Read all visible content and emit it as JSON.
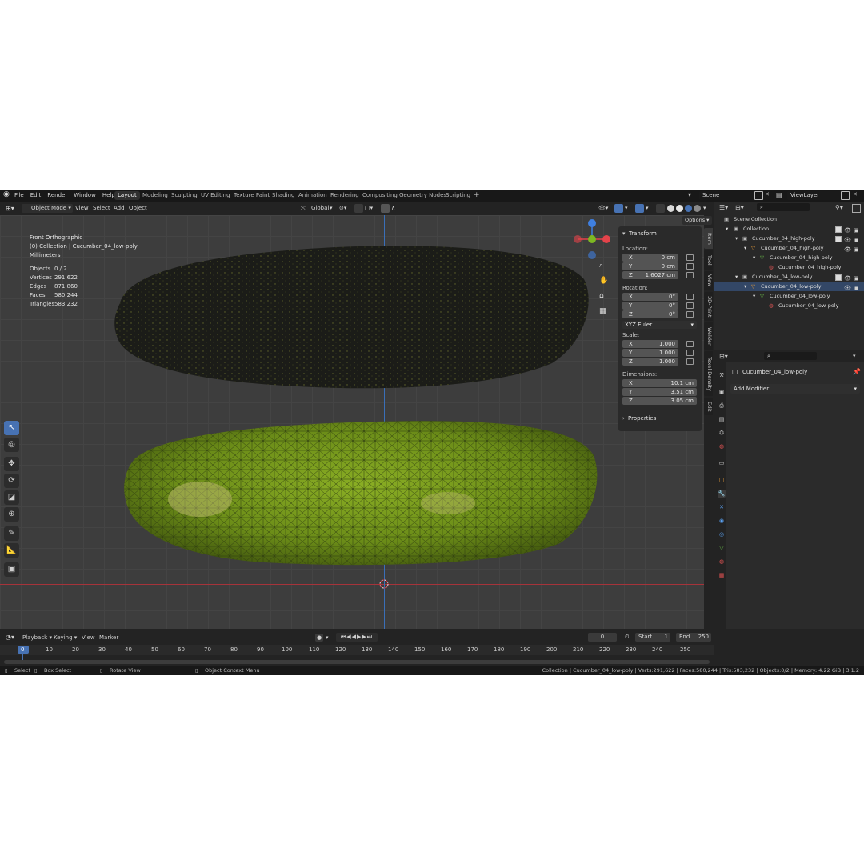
{
  "menu": {
    "items": [
      "File",
      "Edit",
      "Render",
      "Window",
      "Help"
    ]
  },
  "workspaces": [
    "Layout",
    "Modeling",
    "Sculpting",
    "UV Editing",
    "Texture Paint",
    "Shading",
    "Animation",
    "Rendering",
    "Compositing",
    "Geometry Nodes",
    "Scripting"
  ],
  "workspace_add": "+",
  "scene": "Scene",
  "view_layer": "ViewLayer",
  "viewport_header": {
    "mode": "Object Mode",
    "view": "View",
    "select": "Select",
    "add": "Add",
    "object": "Object",
    "orientation": "Global",
    "options": "Options"
  },
  "overlay": {
    "view_name": "Front Orthographic",
    "collection": "(0) Collection | Cucumber_04_low-poly",
    "units": "Millimeters"
  },
  "stats": [
    {
      "label": "Objects",
      "value": "0 / 2"
    },
    {
      "label": "Vertices",
      "value": "291,622"
    },
    {
      "label": "Edges",
      "value": "871,860"
    },
    {
      "label": "Faces",
      "value": "580,244"
    },
    {
      "label": "Triangles",
      "value": "583,232"
    }
  ],
  "n_panel": {
    "section": "Transform",
    "location_label": "Location:",
    "location": [
      {
        "axis": "X",
        "value": "0 cm"
      },
      {
        "axis": "Y",
        "value": "0 cm"
      },
      {
        "axis": "Z",
        "value": "1.6027 cm"
      }
    ],
    "rotation_label": "Rotation:",
    "rotation": [
      {
        "axis": "X",
        "value": "0°"
      },
      {
        "axis": "Y",
        "value": "0°"
      },
      {
        "axis": "Z",
        "value": "0°"
      }
    ],
    "rotation_mode": "XYZ Euler",
    "scale_label": "Scale:",
    "scale": [
      {
        "axis": "X",
        "value": "1.000"
      },
      {
        "axis": "Y",
        "value": "1.000"
      },
      {
        "axis": "Z",
        "value": "1.000"
      }
    ],
    "dimensions_label": "Dimensions:",
    "dimensions": [
      {
        "axis": "X",
        "value": "10.1 cm"
      },
      {
        "axis": "Y",
        "value": "3.51 cm"
      },
      {
        "axis": "Z",
        "value": "3.05 cm"
      }
    ],
    "properties": "Properties"
  },
  "side_tabs": [
    "Item",
    "Tool",
    "View",
    "3D-Print",
    "Welder",
    "Texel Density",
    "Edit"
  ],
  "outliner": {
    "scene_collection": "Scene Collection",
    "collection": "Collection",
    "high_obj": "Cucumber_04_high-poly",
    "high_mod": "Cucumber_04_high-poly",
    "high_mesh": "Cucumber_04_high-poly",
    "high_mat": "Cucumber_04_high-poly",
    "low_obj": "Cucumber_04_low-poly",
    "low_mod": "Cucumber_04_low-poly",
    "low_mesh": "Cucumber_04_low-poly",
    "low_mat": "Cucumber_04_low-poly"
  },
  "properties_panel": {
    "object_name": "Cucumber_04_low-poly",
    "add_modifier": "Add Modifier"
  },
  "timeline": {
    "playback": "Playback",
    "keying": "Keying",
    "view": "View",
    "marker": "Marker",
    "current_frame": "0",
    "start_label": "Start",
    "start": "1",
    "end_label": "End",
    "end": "250",
    "frames": [
      "0",
      "10",
      "20",
      "30",
      "40",
      "50",
      "60",
      "70",
      "80",
      "90",
      "100",
      "110",
      "120",
      "130",
      "140",
      "150",
      "160",
      "170",
      "180",
      "190",
      "200",
      "210",
      "220",
      "230",
      "240",
      "250"
    ]
  },
  "status_bar": {
    "select": "Select",
    "box_select": "Box Select",
    "rotate_view": "Rotate View",
    "context_menu": "Object Context Menu",
    "info": "Collection | Cucumber_04_low-poly | Verts:291,622 | Faces:580,244 | Tris:583,232 | Objects:0/2 | Memory: 4.22 GiB | 3.1.2"
  },
  "colors": {
    "accent": "#4772b3",
    "bg": "#232323",
    "viewport": "#3d3d3d",
    "axis_x": "#e4434a",
    "axis_y": "#7db822",
    "axis_z": "#3f7fe0",
    "cucumber": "#7ea321"
  },
  "icons": [
    "blender-logo-icon",
    "select-cursor-icon",
    "cursor-icon",
    "move-icon",
    "rotate-icon",
    "scale-icon",
    "transform-icon",
    "annotate-icon",
    "measure-icon",
    "add-cube-icon",
    "zoom-icon",
    "hand-icon",
    "camera-icon",
    "grid-icon",
    "wrench-icon",
    "lock-icon",
    "eye-icon",
    "camera-small-icon"
  ]
}
